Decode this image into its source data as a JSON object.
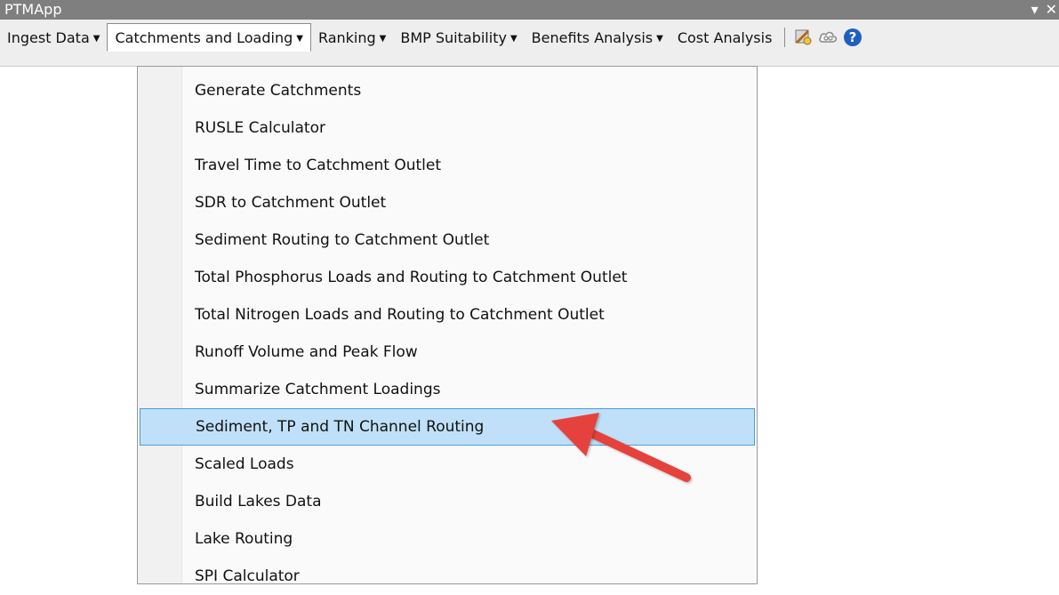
{
  "window": {
    "title": "PTMApp",
    "controls": [
      "▾",
      "✕"
    ]
  },
  "menubar": {
    "items": [
      {
        "label": "Ingest Data"
      },
      {
        "label": "Catchments and Loading"
      },
      {
        "label": "Ranking"
      },
      {
        "label": "BMP Suitability"
      },
      {
        "label": "Benefits Analysis"
      },
      {
        "label": "Cost Analysis"
      }
    ],
    "icons": [
      "tools-icon",
      "cloud-icon",
      "help-icon"
    ]
  },
  "dropdown": {
    "items": [
      {
        "label": "Generate Catchments"
      },
      {
        "label": "RUSLE Calculator"
      },
      {
        "label": "Travel Time to Catchment Outlet"
      },
      {
        "label": "SDR to Catchment Outlet"
      },
      {
        "label": "Sediment Routing to Catchment Outlet"
      },
      {
        "label": "Total Phosphorus Loads and Routing to Catchment Outlet"
      },
      {
        "label": "Total Nitrogen Loads and Routing to Catchment Outlet"
      },
      {
        "label": "Runoff Volume and Peak Flow"
      },
      {
        "label": "Summarize Catchment Loadings"
      },
      {
        "label": "Sediment, TP and TN Channel Routing"
      },
      {
        "label": "Scaled Loads"
      },
      {
        "label": "Build Lakes Data"
      },
      {
        "label": "Lake Routing"
      },
      {
        "label": "SPI Calculator"
      }
    ],
    "highlighted_index": 9
  },
  "colors": {
    "titlebar": "#7f7f7f",
    "highlight": "#bfe0f8",
    "highlight_border": "#4d9fd8",
    "arrow": "#e5433e"
  }
}
